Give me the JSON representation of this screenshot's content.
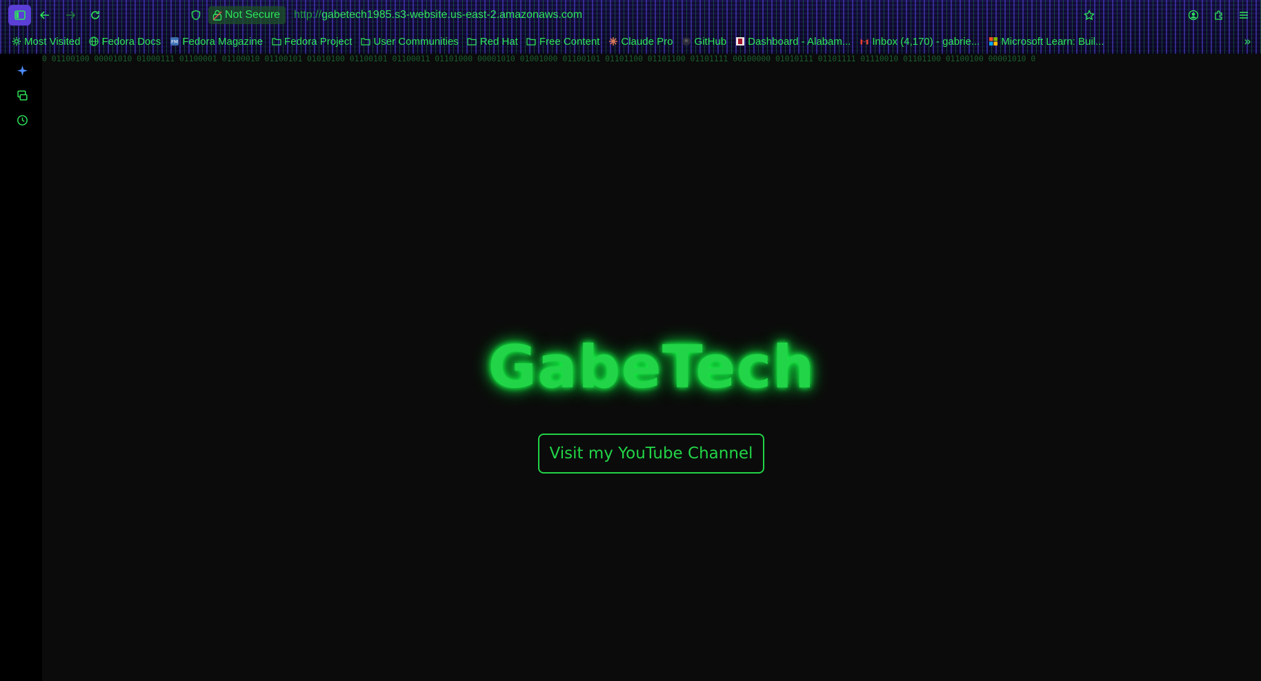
{
  "browser": {
    "security_label": "Not Secure",
    "url_scheme": "http://",
    "url_host": "gabetech1985.s3-website.us-east-2.amazonaws.com",
    "bookmarks": [
      {
        "label": "Most Visited",
        "icon": "gear-icon"
      },
      {
        "label": "Fedora Docs",
        "icon": "globe-icon"
      },
      {
        "label": "Fedora Magazine",
        "icon": "fedora-magazine-icon"
      },
      {
        "label": "Fedora Project",
        "icon": "folder-icon"
      },
      {
        "label": "User Communities",
        "icon": "folder-icon"
      },
      {
        "label": "Red Hat",
        "icon": "folder-icon"
      },
      {
        "label": "Free Content",
        "icon": "folder-icon"
      },
      {
        "label": "Claude Pro",
        "icon": "claude-icon"
      },
      {
        "label": "GitHub",
        "icon": "github-icon"
      },
      {
        "label": "Dashboard - Alabam...",
        "icon": "dashboard-icon"
      },
      {
        "label": "Inbox (4,170) - gabrie...",
        "icon": "gmail-icon"
      },
      {
        "label": "Microsoft Learn: Buil...",
        "icon": "microsoft-icon"
      }
    ],
    "overflow_label": "»"
  },
  "page": {
    "binary_strip": "0 01100100 00001010 01000111 01100001 01100010 01100101 01010100 01100101 01100011 01101000 00001010 01001000 01100101 01101100 01101100 01101111 00100000 01010111 01101111 01110010 01101100 01100100 00001010 0",
    "title": "GabeTech",
    "cta_label": "Visit my YouTube Channel"
  },
  "colors": {
    "accent": "#22d447",
    "sidebar_toggle": "#5b3fd6",
    "background": "#0b0b0b"
  }
}
